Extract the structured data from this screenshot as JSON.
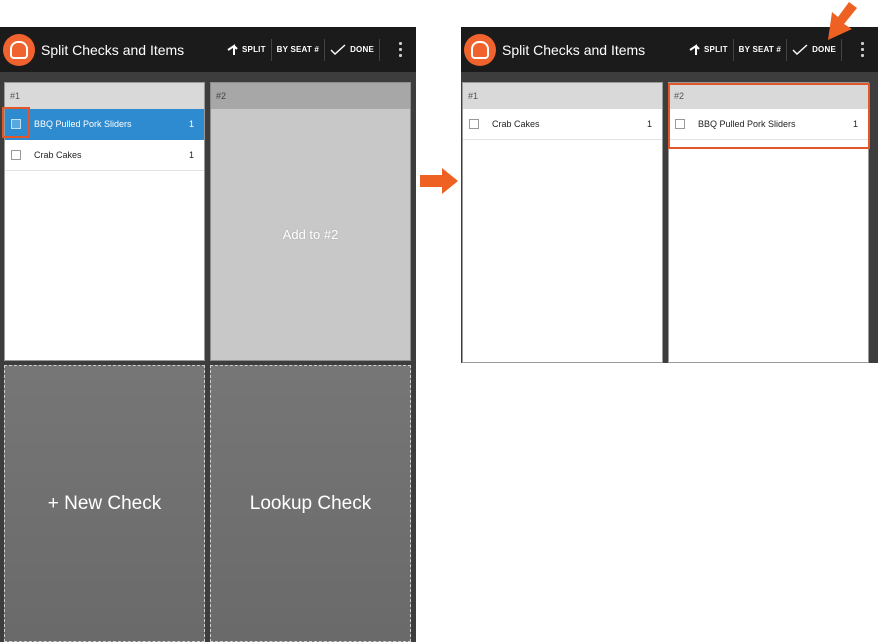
{
  "app": {
    "title": "Split Checks and Items",
    "actions": {
      "split_label": "SPLIT",
      "by_seat_label": "BY SEAT #",
      "done_label": "DONE"
    }
  },
  "before": {
    "checks": [
      {
        "header": "#1",
        "items": [
          {
            "name": "BBQ Pulled Pork Sliders",
            "qty": "1",
            "selected": true
          },
          {
            "name": "Crab Cakes",
            "qty": "1",
            "selected": false
          }
        ]
      }
    ],
    "drop_target": {
      "header": "#2",
      "label": "Add to #2"
    },
    "tiles": {
      "new_check": "+ New Check",
      "lookup_check": "Lookup Check"
    }
  },
  "after": {
    "checks": [
      {
        "header": "#1",
        "items": [
          {
            "name": "Crab Cakes",
            "qty": "1"
          }
        ]
      },
      {
        "header": "#2",
        "items": [
          {
            "name": "BBQ Pulled Pork Sliders",
            "qty": "1"
          }
        ]
      }
    ]
  },
  "colors": {
    "accent_orange": "#e1572a",
    "selected_blue": "#2e8bcf",
    "appbar": "#1b1b1b"
  }
}
